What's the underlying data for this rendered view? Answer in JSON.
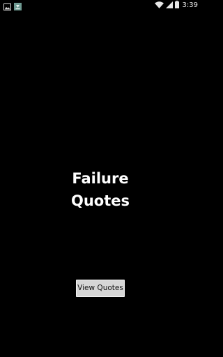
{
  "status_bar": {
    "time": "3:39",
    "left_icons": [
      "image-notification-icon",
      "download-notification-icon"
    ],
    "right_icons": [
      "wifi-icon",
      "signal-icon",
      "battery-icon"
    ]
  },
  "main": {
    "title_line_1": "Failure",
    "title_line_2": "Quotes",
    "view_button_label": "View Quotes"
  },
  "colors": {
    "background": "#000000",
    "title_text": "#ffffff",
    "button_background": "#d6d6d6",
    "button_text": "#111111"
  }
}
